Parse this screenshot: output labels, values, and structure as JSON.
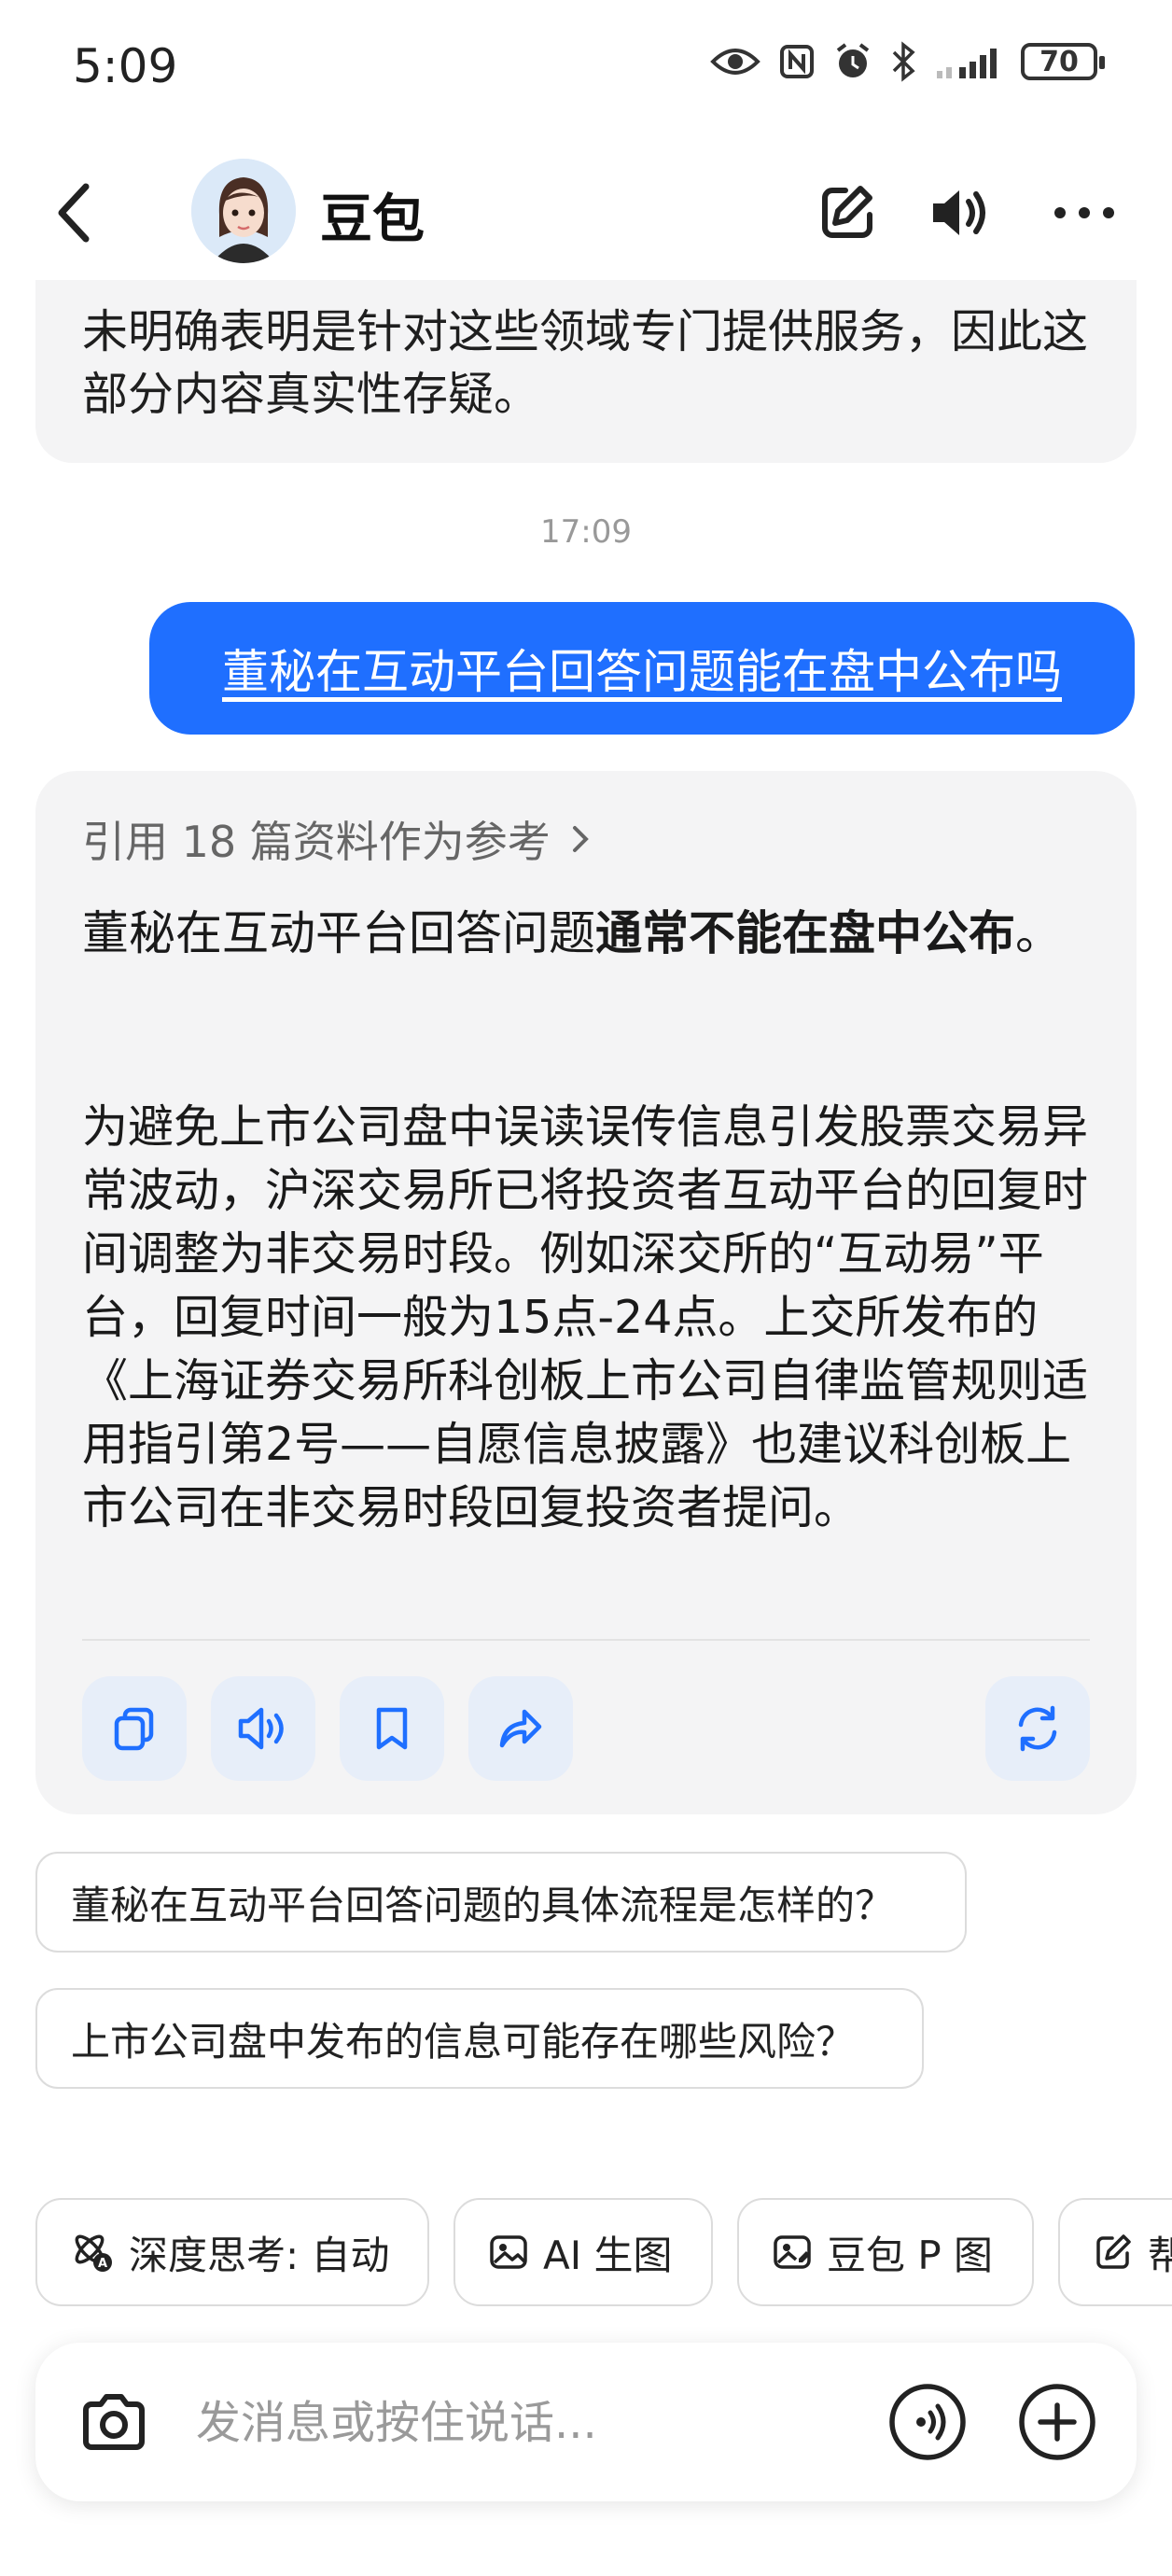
{
  "status_bar": {
    "time": "5:09",
    "battery": "70"
  },
  "header": {
    "title": "豆包"
  },
  "chat": {
    "previous_message_tail": "未明确表明是针对这些领域专门提供服务，因此这部分内容真实性存疑。",
    "timestamp": "17:09",
    "user_message": "董秘在互动平台回答问题能在盘中公布吗",
    "answer": {
      "references": "引用 18 篇资料作为参考",
      "lead_prefix": "董秘在互动平台回答问题",
      "lead_bold": "通常不能在盘中公布",
      "lead_suffix": "。",
      "body": "为避免上市公司盘中误读误传信息引发股票交易异常波动，沪深交易所已将投资者互动平台的回复时间调整为非交易时段。例如深交所的“互动易”平台，回复时间一般为15点-24点。上交所发布的《上海证券交易所科创板上市公司自律监管规则适用指引第2号——自愿信息披露》也建议科创板上市公司在非交易时段回复投资者提问。"
    },
    "suggestions": [
      "董秘在互动平台回答问题的具体流程是怎样的？",
      "上市公司盘中发布的信息可能存在哪些风险？"
    ]
  },
  "chips": [
    {
      "label": "深度思考: 自动",
      "icon": "deep-think-icon"
    },
    {
      "label": "AI 生图",
      "icon": "image-icon"
    },
    {
      "label": "豆包 P 图",
      "icon": "photo-edit-icon"
    },
    {
      "label": "帮",
      "icon": "write-icon"
    }
  ],
  "input": {
    "placeholder": "发消息或按住说话..."
  },
  "colors": {
    "accent": "#1f6fff",
    "card_bg": "#f4f4f5",
    "action_bg": "#e7eef9"
  }
}
